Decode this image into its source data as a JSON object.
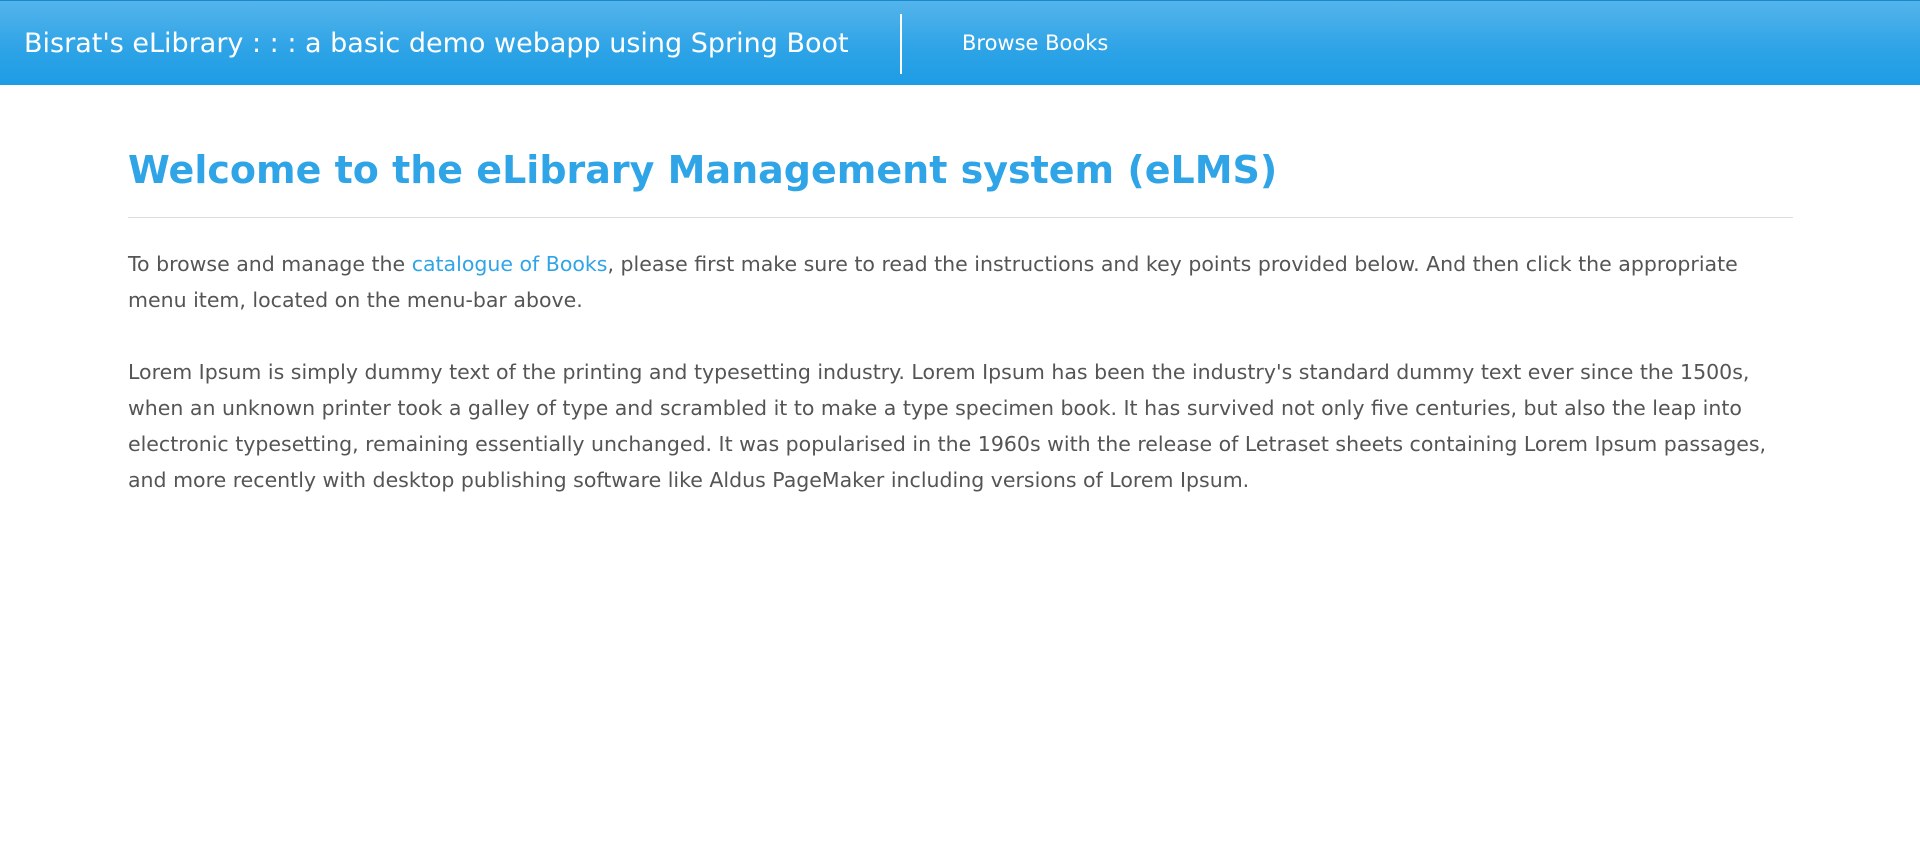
{
  "navbar": {
    "brand": "Bisrat's eLibrary : : : a basic demo webapp using Spring Boot",
    "links": [
      {
        "label": "Browse Books"
      }
    ]
  },
  "main": {
    "title": "Welcome to the eLibrary Management system (eLMS)",
    "intro": {
      "before": "To browse and manage the ",
      "link": "catalogue of Books",
      "after": ", please first make sure to read the instructions and key points provided below. And then click the appropriate menu item, located on the menu-bar above."
    },
    "body": "Lorem Ipsum is simply dummy text of the printing and typesetting industry. Lorem Ipsum has been the industry's standard dummy text ever since the 1500s, when an unknown printer took a galley of type and scrambled it to make a type specimen book. It has survived not only five centuries, but also the leap into electronic typesetting, remaining essentially unchanged. It was popularised in the 1960s with the release of Letraset sheets containing Lorem Ipsum passages, and more recently with desktop publishing software like Aldus PageMaker including versions of Lorem Ipsum."
  },
  "colors": {
    "accent": "#2fa4e7",
    "text": "#555555",
    "navbar_text": "#ffffff",
    "rule": "#dddddd"
  }
}
